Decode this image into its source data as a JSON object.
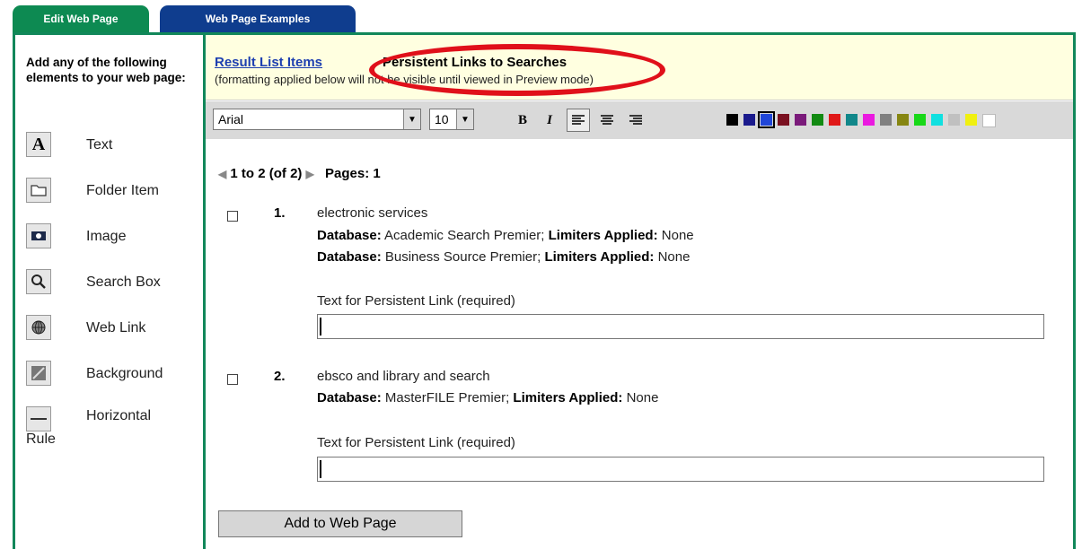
{
  "tabs": [
    {
      "label": "Edit Web Page"
    },
    {
      "label": "Web Page Examples"
    }
  ],
  "left_panel": {
    "heading": "Add any of the following elements to your web page:",
    "elements": [
      {
        "label": "Text",
        "icon": "text-icon"
      },
      {
        "label": "Folder Item",
        "icon": "folder-icon"
      },
      {
        "label": "Image",
        "icon": "image-icon"
      },
      {
        "label": "Search Box",
        "icon": "search-icon"
      },
      {
        "label": "Web Link",
        "icon": "web-link-icon"
      },
      {
        "label": "Background",
        "icon": "background-icon"
      },
      {
        "label": "Horizontal",
        "label2": "Rule",
        "icon": "horizontal-rule-icon"
      }
    ]
  },
  "header": {
    "link": "Result List Items",
    "title": "Persistent Links to Searches",
    "note": "(formatting applied below will not be visible until viewed in Preview mode)"
  },
  "toolbar": {
    "font": "Arial",
    "size": "10",
    "bold_label": "B",
    "italic_label": "I",
    "swatches": [
      "#000000",
      "#1a1a8c",
      "#2046d8",
      "#7a1020",
      "#7a1a7a",
      "#128a12",
      "#e01818",
      "#11878a",
      "#ea1ae0",
      "#808080",
      "#868612",
      "#18d818",
      "#10e0e0",
      "#c0c0c0",
      "#f0f010",
      "#ffffff"
    ]
  },
  "pager": {
    "range": "1 to 2 (of 2)",
    "pages": "Pages: 1"
  },
  "items": [
    {
      "num": "1.",
      "query": "electronic services",
      "db_label": "Database:",
      "lim_label": "Limiters Applied:",
      "lim_value": "None",
      "databases": [
        "Academic Search Premier",
        "Business Source Premier"
      ],
      "field_label": "Text for Persistent Link (required)"
    },
    {
      "num": "2.",
      "query": "ebsco and library and search",
      "db_label": "Database:",
      "lim_label": "Limiters Applied:",
      "lim_value": "None",
      "databases": [
        "MasterFILE Premier"
      ],
      "field_label": "Text for Persistent Link (required)"
    }
  ],
  "submit": {
    "label": "Add to Web Page"
  },
  "colors": {
    "tab_green": "#0d8a52",
    "tab_blue": "#0f3d8e",
    "frame_green": "#11875a",
    "header_bg": "#ffffe0",
    "highlight_red": "#e0101a",
    "link_blue": "#1d3fb0"
  }
}
